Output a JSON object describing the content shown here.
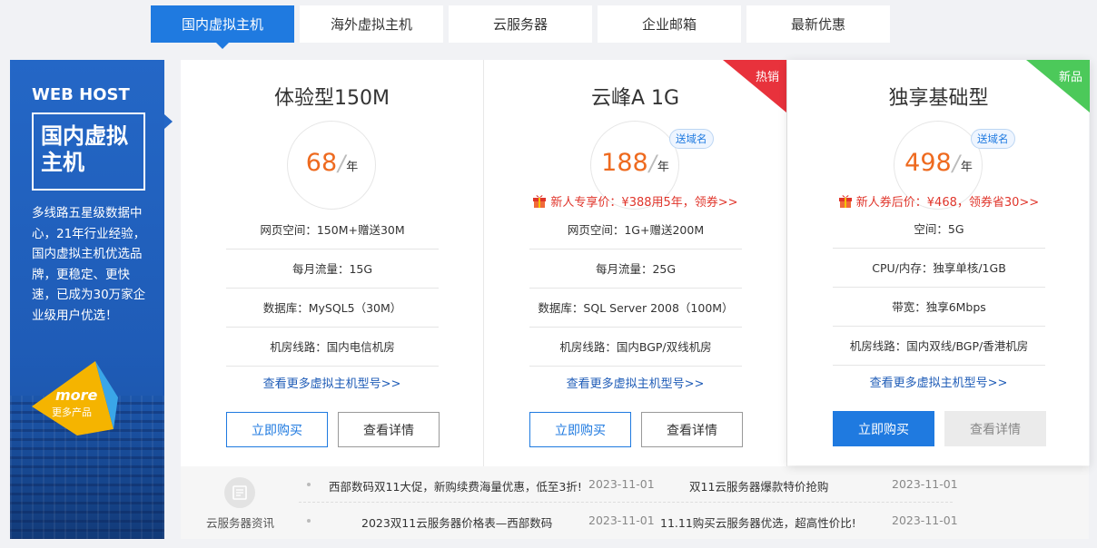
{
  "tabs": [
    "国内虚拟主机",
    "海外虚拟主机",
    "云服务器",
    "企业邮箱",
    "最新优惠"
  ],
  "banner": {
    "title_en": "WEB HOST",
    "title_cn_line1": "国内虚拟",
    "title_cn_line2": "主机",
    "description": "多线路五星级数据中心，21年行业经验，国内虚拟主机优选品牌，更稳定、更快速，已成为30万家企业级用户优选！",
    "more_en": "more",
    "more_cn": "更多产品"
  },
  "cards": [
    {
      "title": "体验型150M",
      "price": "68",
      "unit": "年",
      "specs": [
        "网页空间：150M+赠送30M",
        "每月流量：15G",
        "数据库：MySQL5（30M）",
        "机房线路：国内电信机房"
      ],
      "more_link": "查看更多虚拟主机型号>>",
      "buy_label": "立即购买",
      "detail_label": "查看详情"
    },
    {
      "title": "云峰A 1G",
      "price": "188",
      "unit": "年",
      "gift_tag": "送域名",
      "promo": "新人专享价：¥388用5年，领券>>",
      "corner": "热销",
      "specs": [
        "网页空间：1G+赠送200M",
        "每月流量：25G",
        "数据库：SQL Server 2008（100M）",
        "机房线路：国内BGP/双线机房"
      ],
      "more_link": "查看更多虚拟主机型号>>",
      "buy_label": "立即购买",
      "detail_label": "查看详情"
    },
    {
      "title": "独享基础型",
      "price": "498",
      "unit": "年",
      "gift_tag": "送域名",
      "promo": "新人券后价：¥468，领券省30>>",
      "corner": "新品",
      "specs": [
        "空间：5G",
        "CPU/内存：独享单核/1GB",
        "带宽：独享6Mbps",
        "机房线路：国内双线/BGP/香港机房"
      ],
      "more_link": "查看更多虚拟主机型号>>",
      "buy_label": "立即购买",
      "detail_label": "查看详情"
    }
  ],
  "news": {
    "label": "云服务器资讯",
    "items": [
      {
        "title": "西部数码双11大促，新购续费海量优惠，低至3折!",
        "date": "2023-11-01"
      },
      {
        "title": "双11云服务器爆款特价抢购",
        "date": "2023-11-01"
      },
      {
        "title": "2023双11云服务器价格表—西部数码",
        "date": "2023-11-01"
      },
      {
        "title": "11.11购买云服务器优选，超高性价比!",
        "date": "2023-11-01"
      }
    ]
  },
  "colors": {
    "accent": "#1f7ae0",
    "price": "#ee6a1f",
    "promo": "#e0352b",
    "hot_corner": "#e8323c",
    "new_corner": "#4cc95a"
  }
}
